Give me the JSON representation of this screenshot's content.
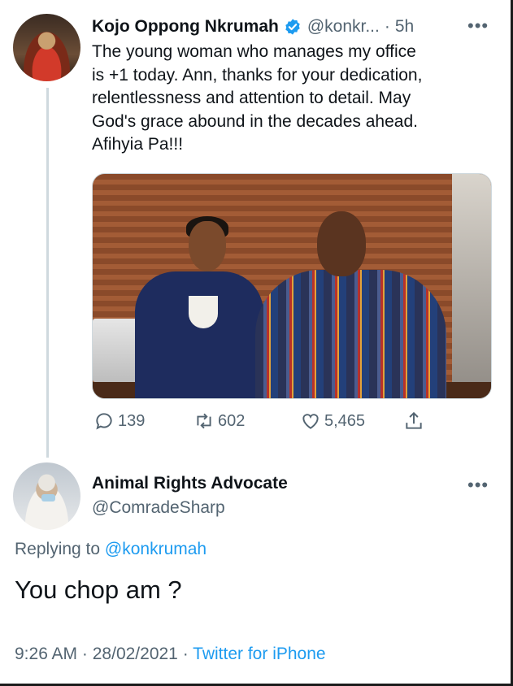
{
  "parent_tweet": {
    "author_name": "Kojo Oppong Nkrumah",
    "handle": "@konkr...",
    "separator": "·",
    "time": "5h",
    "more": "•••",
    "text": "The young woman who manages my office\nis +1 today. Ann, thanks for your dedication,\nrelentlessness and attention to detail. May\nGod's grace abound in the decades ahead.\nAfihyia Pa!!!",
    "stats": {
      "replies": "139",
      "retweets": "602",
      "likes": "5,465"
    },
    "icons": [
      "reply-icon",
      "retweet-icon",
      "like-icon",
      "share-icon"
    ],
    "verified": true
  },
  "reply_tweet": {
    "author_name": "Animal Rights Advocate",
    "handle": "@ComradeSharp",
    "more": "•••",
    "replying_prefix": "Replying to",
    "replying_to": "@konkrumah",
    "text": "You chop am ?",
    "time": "9:26 AM",
    "date": "28/02/2021",
    "separator": "·",
    "source": "Twitter for iPhone"
  },
  "colors": {
    "accent": "#1d9bf0",
    "secondary_text": "#536471",
    "primary_text": "#0f1419",
    "thread_line": "#cfd9de"
  }
}
